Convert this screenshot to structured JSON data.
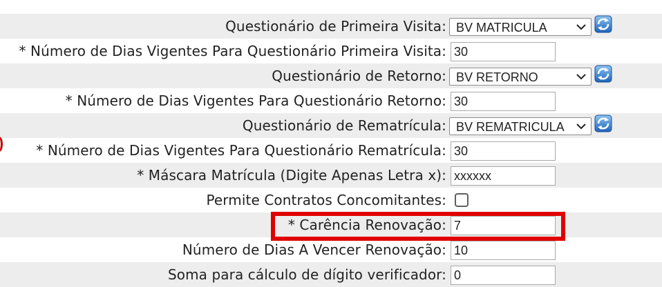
{
  "form": {
    "rows": [
      {
        "label": "Questionário de Primeira Visita:",
        "type": "select",
        "value": "BV MATRICULA",
        "has_refresh": true
      },
      {
        "label": "* Número de Dias Vigentes Para Questionário Primeira Visita:",
        "type": "text",
        "value": "30"
      },
      {
        "label": "Questionário de Retorno:",
        "type": "select",
        "value": "BV RETORNO",
        "has_refresh": true
      },
      {
        "label": "* Número de Dias Vigentes Para Questionário Retorno:",
        "type": "text",
        "value": "30"
      },
      {
        "label": "Questionário de Rematrícula:",
        "type": "select",
        "value": "BV REMATRICULA",
        "has_refresh": true
      },
      {
        "label": "* Número de Dias Vigentes Para Questionário Rematrícula:",
        "type": "text",
        "value": "30"
      },
      {
        "label": "* Máscara Matrícula (Digite Apenas Letra x):",
        "type": "text",
        "value": "xxxxxx"
      },
      {
        "label": "Permite Contratos Concomitantes:",
        "type": "checkbox",
        "checked": false
      },
      {
        "label": "* Carência Renovação:",
        "type": "text",
        "value": "7",
        "highlighted": true
      },
      {
        "label": "Número de Dias A Vencer Renovação:",
        "type": "text",
        "value": "10"
      },
      {
        "label": "Soma para cálculo de dígito verificador:",
        "type": "text",
        "value": "0"
      }
    ]
  },
  "icons": {
    "select_arrow": "chevron-down-icon",
    "refresh": "refresh-icon"
  },
  "colors": {
    "row_shade": "#ededed",
    "highlight_border": "#e00000",
    "text": "#222222",
    "refresh_blue": "#2f7fd6"
  }
}
